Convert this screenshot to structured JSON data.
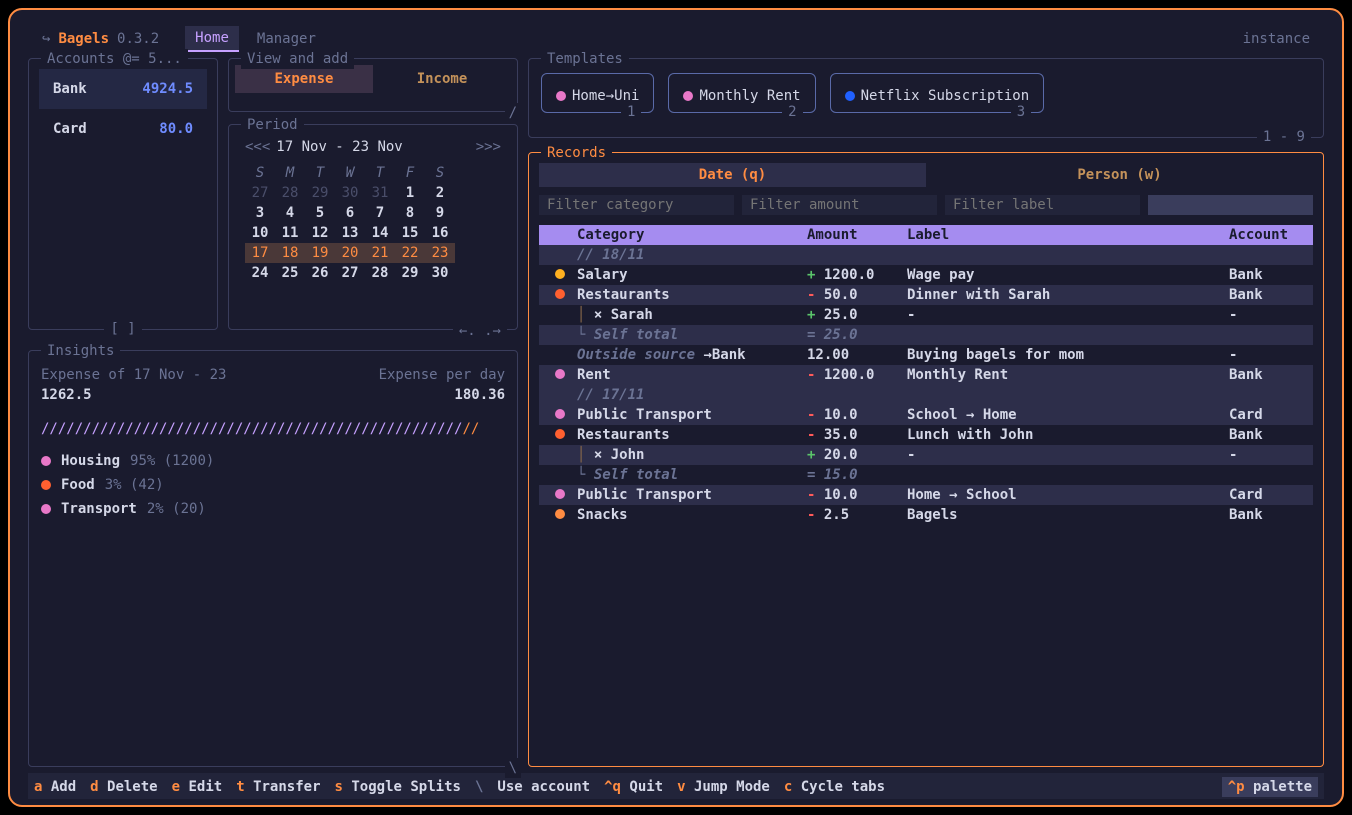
{
  "app": {
    "name": "Bagels",
    "version": "0.3.2",
    "tabs": [
      "Home",
      "Manager"
    ],
    "active_tab": "Home",
    "instance_label": "instance"
  },
  "accounts": {
    "title": "Accounts @= 5...",
    "items": [
      {
        "name": "Bank",
        "balance": "4924.5",
        "selected": true
      },
      {
        "name": "Card",
        "balance": "80.0",
        "selected": false
      }
    ],
    "footer": "[ ]"
  },
  "view": {
    "title": "View and add",
    "tabs": [
      "Expense",
      "Income"
    ],
    "active": "Expense"
  },
  "period": {
    "title": "Period",
    "nav_prev": "<<<",
    "range": "17 Nov - 23 Nov",
    "nav_next": ">>>",
    "dow": [
      "S",
      "M",
      "T",
      "W",
      "T",
      "F",
      "S"
    ],
    "rows": [
      [
        {
          "d": "27",
          "dim": true
        },
        {
          "d": "28",
          "dim": true
        },
        {
          "d": "29",
          "dim": true
        },
        {
          "d": "30",
          "dim": true
        },
        {
          "d": "31",
          "dim": true
        },
        {
          "d": "1"
        },
        {
          "d": "2"
        }
      ],
      [
        {
          "d": "3"
        },
        {
          "d": "4"
        },
        {
          "d": "5"
        },
        {
          "d": "6"
        },
        {
          "d": "7"
        },
        {
          "d": "8"
        },
        {
          "d": "9"
        }
      ],
      [
        {
          "d": "10"
        },
        {
          "d": "11"
        },
        {
          "d": "12"
        },
        {
          "d": "13"
        },
        {
          "d": "14"
        },
        {
          "d": "15"
        },
        {
          "d": "16"
        }
      ],
      [
        {
          "d": "17",
          "hl": true
        },
        {
          "d": "18",
          "hl": true
        },
        {
          "d": "19",
          "hl": true
        },
        {
          "d": "20",
          "hl": true
        },
        {
          "d": "21",
          "hl": true
        },
        {
          "d": "22",
          "hl": true
        },
        {
          "d": "23",
          "hl": true
        }
      ],
      [
        {
          "d": "24"
        },
        {
          "d": "25"
        },
        {
          "d": "26"
        },
        {
          "d": "27"
        },
        {
          "d": "28"
        },
        {
          "d": "29"
        },
        {
          "d": "30"
        }
      ]
    ],
    "footer": "←. .→"
  },
  "insights": {
    "title": "Insights",
    "expense_label": "Expense of 17 Nov - 23",
    "expense_value": "1262.5",
    "perday_label": "Expense per day",
    "perday_value": "180.36",
    "categories": [
      {
        "dot": "pink",
        "name": "Housing",
        "pct": "95%",
        "amt": "(1200)"
      },
      {
        "dot": "red",
        "name": "Food",
        "pct": "3%",
        "amt": "(42)"
      },
      {
        "dot": "pink",
        "name": "Transport",
        "pct": "2%",
        "amt": "(20)"
      }
    ]
  },
  "templates": {
    "title": "Templates",
    "items": [
      {
        "dot": "pink",
        "label": "Home→Uni",
        "key": "1"
      },
      {
        "dot": "pink",
        "label": "Monthly Rent",
        "key": "2"
      },
      {
        "dot": "blue",
        "label": "Netflix Subscription",
        "key": "3"
      }
    ],
    "paging": "1 - 9"
  },
  "records": {
    "title": "Records",
    "view_tabs": [
      "Date (q)",
      "Person (w)"
    ],
    "active_view": "Date (q)",
    "filters": {
      "category_ph": "Filter category",
      "amount_ph": "Filter amount",
      "label_ph": "Filter label"
    },
    "headers": {
      "category": "Category",
      "amount": "Amount",
      "label": "Label",
      "account": "Account"
    },
    "rows": [
      {
        "type": "date",
        "text": "//  18/11"
      },
      {
        "type": "rec",
        "dot": "yellow",
        "cat": "Salary",
        "sign": "+",
        "amt": "1200.0",
        "label": "Wage pay",
        "acct": "Bank",
        "alt": false
      },
      {
        "type": "rec",
        "dot": "red",
        "cat": "Restaurants",
        "sign": "-",
        "amt": "50.0",
        "label": "Dinner with Sarah",
        "acct": "Bank",
        "alt": true
      },
      {
        "type": "sub",
        "cat": "× Sarah",
        "sign": "+",
        "amt": "25.0",
        "label": "-",
        "acct": "-",
        "alt": false,
        "bracket": true
      },
      {
        "type": "self",
        "cat": "Self total",
        "sign": "=",
        "amt": "25.0",
        "alt": true
      },
      {
        "type": "out",
        "cat": "Outside source →Bank",
        "amt": "12.00",
        "label": "Buying bagels for mom",
        "acct": "-",
        "alt": false
      },
      {
        "type": "rec",
        "dot": "pink",
        "cat": "Rent",
        "sign": "-",
        "amt": "1200.0",
        "label": "Monthly Rent",
        "acct": "Bank",
        "alt": true
      },
      {
        "type": "date",
        "text": "//  17/11"
      },
      {
        "type": "rec",
        "dot": "pink",
        "cat": "Public Transport",
        "sign": "-",
        "amt": "10.0",
        "label": "School → Home",
        "acct": "Card",
        "alt": true
      },
      {
        "type": "rec",
        "dot": "red",
        "cat": "Restaurants",
        "sign": "-",
        "amt": "35.0",
        "label": "Lunch with John",
        "acct": "Bank",
        "alt": false
      },
      {
        "type": "sub",
        "cat": "× John",
        "sign": "+",
        "amt": "20.0",
        "label": "-",
        "acct": "-",
        "alt": true,
        "bracket": true
      },
      {
        "type": "self",
        "cat": "Self total",
        "sign": "=",
        "amt": "15.0",
        "alt": false
      },
      {
        "type": "rec",
        "dot": "pink",
        "cat": "Public Transport",
        "sign": "-",
        "amt": "10.0",
        "label": "Home → School",
        "acct": "Card",
        "alt": true
      },
      {
        "type": "rec",
        "dot": "orange",
        "cat": "Snacks",
        "sign": "-",
        "amt": "2.5",
        "label": "Bagels",
        "acct": "Bank",
        "alt": false
      }
    ]
  },
  "footer": {
    "items": [
      {
        "key": "a",
        "label": "Add"
      },
      {
        "key": "d",
        "label": "Delete"
      },
      {
        "key": "e",
        "label": "Edit"
      },
      {
        "key": "t",
        "label": "Transfer"
      },
      {
        "key": "s",
        "label": "Toggle Splits"
      },
      {
        "sep": "\\"
      },
      {
        "label_only": "Use account"
      },
      {
        "key": "^q",
        "label": "Quit"
      },
      {
        "key": "v",
        "label": "Jump Mode"
      },
      {
        "key": "c",
        "label": "Cycle tabs"
      }
    ],
    "right": {
      "key": "^p",
      "label": "palette"
    }
  }
}
